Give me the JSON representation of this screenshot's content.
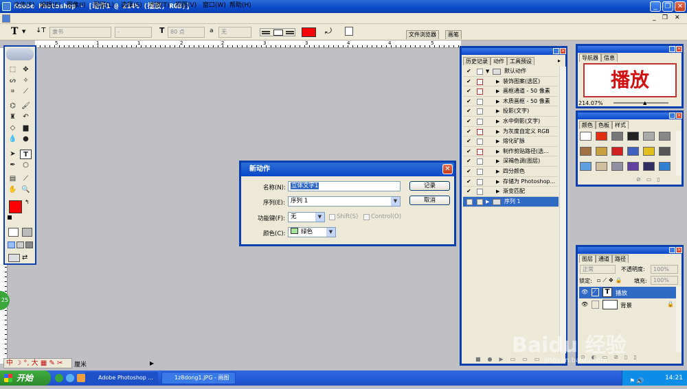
{
  "app": {
    "title": "Adobe Photoshop - [动作1 @ 214% (播放, RGB)]"
  },
  "menu": [
    "文件(F)",
    "编辑(E)",
    "图像(I)",
    "图层(L)",
    "选择(S)",
    "滤镜(T)",
    "视图(V)",
    "窗口(W)",
    "帮助(H)"
  ],
  "options": {
    "tool_glyph": "T",
    "orient_glyph": "↓T",
    "font_family": "隶书",
    "font_style": "-",
    "size_glyph": "T",
    "font_size": "80 点",
    "aa_glyph": "a",
    "aa_value": "无",
    "text_color": "#ff0000",
    "file_browser_tab": "文件浏览器",
    "brushes_tab": "画笔"
  },
  "ruler_marks": [
    "0",
    "5",
    "1",
    "1",
    "2",
    "2",
    "3",
    "3",
    "4",
    "4",
    "5"
  ],
  "actions_panel": {
    "tabs": [
      "历史记录",
      "动作",
      "工具预设"
    ],
    "set_name": "默认动作",
    "rows": [
      {
        "label": "装饰图案(选区)",
        "red": true
      },
      {
        "label": "画框通道 - 50 像素",
        "red": true
      },
      {
        "label": "木质画框 - 50 像素",
        "red": false
      },
      {
        "label": "投影(文字)",
        "red": false
      },
      {
        "label": "水中倒影(文字)",
        "red": false
      },
      {
        "label": "为灰度自定义 RGB",
        "red": true
      },
      {
        "label": "熔化矿脉",
        "red": false
      },
      {
        "label": "制作剪贴路径(选...",
        "red": true
      },
      {
        "label": "深褐色调(图层)",
        "red": false
      },
      {
        "label": "四分颜色",
        "red": false
      },
      {
        "label": "存储为 Photoshop...",
        "red": false
      },
      {
        "label": "渐变匹配",
        "red": false
      }
    ],
    "new_set": "序列 1"
  },
  "navigator": {
    "tabs": [
      "导航器",
      "信息"
    ],
    "preview_text": "播放",
    "zoom": "214.07%"
  },
  "styles": {
    "tabs": [
      "颜色",
      "色板",
      "样式"
    ],
    "swatches": [
      "#fff",
      "#e03010",
      "#777",
      "#222",
      "#aaa",
      "#888",
      "#a07040",
      "#c8a040",
      "#d02020",
      "#4060c0",
      "#e0c020",
      "#555",
      "#60a0e0",
      "#d0c0a0",
      "#9090a0",
      "#6040a0",
      "#303060",
      "#3080d0"
    ]
  },
  "layers": {
    "tabs": [
      "图层",
      "通道",
      "路径"
    ],
    "blend": "正常",
    "opacity_label": "不透明度:",
    "opacity": "100%",
    "lock_label": "锁定:",
    "fill_label": "填充:",
    "fill": "100%",
    "items": [
      {
        "name": "播放",
        "type_glyph": "T",
        "selected": true
      },
      {
        "name": "背景",
        "type_glyph": "",
        "selected": false
      }
    ]
  },
  "dialog": {
    "title": "新动作",
    "name_label": "名称(N):",
    "name_value": "立体文字1",
    "record": "记录",
    "set_label": "序列(E):",
    "set_value": "序列 1",
    "cancel": "取消",
    "fkey_label": "功能键(F):",
    "fkey_value": "无",
    "shift": "Shift(S)",
    "control": "Control(O)",
    "color_label": "颜色(C):",
    "color_value": "绿色",
    "color_hex": "#a8e0a0"
  },
  "status": {
    "ime": "中",
    "unit": "厘米",
    "badge": "25"
  },
  "taskbar": {
    "start": "开始",
    "tasks": [
      "Adobe Photoshop ...",
      "1z8dong1.JPG - 画图"
    ],
    "time": "14:21"
  },
  "watermark": {
    "text": "Baidu 经验",
    "url": "jingyan.baidu.com"
  }
}
